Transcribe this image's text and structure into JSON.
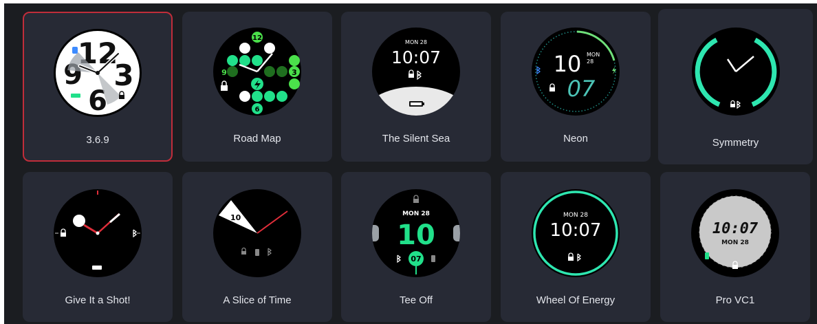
{
  "watchfaces": [
    {
      "name": "3.6.9",
      "selected": true
    },
    {
      "name": "Road Map",
      "selected": false
    },
    {
      "name": "The Silent Sea",
      "selected": false
    },
    {
      "name": "Neon",
      "selected": false
    },
    {
      "name": "Symmetry",
      "selected": false
    },
    {
      "name": "Give It a Shot!",
      "selected": false
    },
    {
      "name": "A Slice of Time",
      "selected": false
    },
    {
      "name": "Tee Off",
      "selected": false
    },
    {
      "name": "Wheel Of Energy",
      "selected": false
    },
    {
      "name": "Pro VC1",
      "selected": false
    }
  ],
  "faces": {
    "f369": {
      "n12": "12",
      "n9": "9",
      "n6": "6",
      "n3": "3"
    },
    "roadmap": {
      "h12": "12",
      "h9": "9",
      "h3": "3",
      "h6": "6"
    },
    "silentsea": {
      "date": "MON 28",
      "time": "10:07"
    },
    "neon": {
      "hour": "10",
      "day": "MON",
      "date": "28",
      "minute": "07"
    },
    "shot": {},
    "slice": {
      "hour": "10"
    },
    "teeoff": {
      "date": "MON 28",
      "hour": "10",
      "minute": "07"
    },
    "wheel": {
      "date": "MON 28",
      "time": "10:07"
    },
    "provc1": {
      "time": "10:07",
      "date": "MON 28"
    }
  },
  "colors": {
    "panel": "#1b1d21",
    "card": "#272a35",
    "selected_border": "#c12d3a",
    "green": "#21e08a",
    "teal": "#2ee6b0",
    "red": "#e02e3a"
  },
  "icons": [
    "lock-icon",
    "bluetooth-icon",
    "battery-icon",
    "bolt-icon"
  ]
}
